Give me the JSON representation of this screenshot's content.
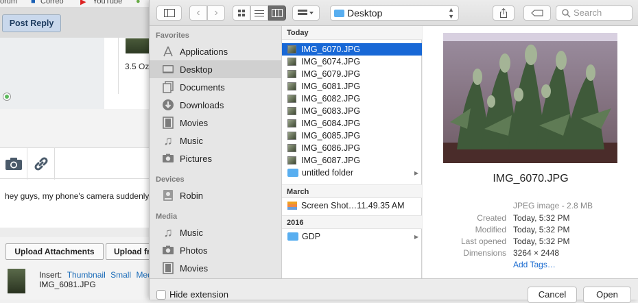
{
  "background": {
    "bookmarks": [
      "orum",
      "Correo",
      "YouTube"
    ],
    "post_reply": "Post Reply",
    "post_text": "3.5 Oz",
    "message": "hey guys, my phone's camera suddenly",
    "upload_button": "Upload Attachments",
    "upload_button2": "Upload fr",
    "insert_label": "Insert:",
    "insert_links": [
      "Thumbnail",
      "Small",
      "Med"
    ],
    "attachment_name": "IMG_6081.JPG"
  },
  "dialog": {
    "location": "Desktop",
    "search_placeholder": "Search",
    "sidebar": {
      "favorites_header": "Favorites",
      "favorites": [
        {
          "label": "Applications",
          "icon": "applications-icon"
        },
        {
          "label": "Desktop",
          "icon": "desktop-icon",
          "selected": true
        },
        {
          "label": "Documents",
          "icon": "documents-icon"
        },
        {
          "label": "Downloads",
          "icon": "downloads-icon"
        },
        {
          "label": "Movies",
          "icon": "movies-icon"
        },
        {
          "label": "Music",
          "icon": "music-icon"
        },
        {
          "label": "Pictures",
          "icon": "pictures-icon"
        }
      ],
      "devices_header": "Devices",
      "devices": [
        {
          "label": "Robin",
          "icon": "harddisk-icon"
        }
      ],
      "media_header": "Media",
      "media": [
        {
          "label": "Music",
          "icon": "music-icon"
        },
        {
          "label": "Photos",
          "icon": "photos-icon"
        },
        {
          "label": "Movies",
          "icon": "movies-icon"
        }
      ]
    },
    "groups": [
      {
        "header": "Today",
        "items": [
          "IMG_6070.JPG",
          "IMG_6074.JPG",
          "IMG_6079.JPG",
          "IMG_6081.JPG",
          "IMG_6082.JPG",
          "IMG_6083.JPG",
          "IMG_6084.JPG",
          "IMG_6085.JPG",
          "IMG_6086.JPG",
          "IMG_6087.JPG",
          "untitled folder"
        ]
      },
      {
        "header": "March",
        "items": [
          "Screen Shot…11.49.35 AM"
        ]
      },
      {
        "header": "2016",
        "items": [
          "GDP"
        ]
      }
    ],
    "selected_file": "IMG_6070.JPG",
    "preview": {
      "name": "IMG_6070.JPG",
      "kind": "JPEG image - 2.8 MB",
      "rows": [
        {
          "k": "Created",
          "v": "Today, 5:32 PM"
        },
        {
          "k": "Modified",
          "v": "Today, 5:32 PM"
        },
        {
          "k": "Last opened",
          "v": "Today, 5:32 PM"
        },
        {
          "k": "Dimensions",
          "v": "3264 × 2448"
        }
      ],
      "add_tags": "Add Tags…"
    },
    "hide_extension": "Hide extension",
    "cancel": "Cancel",
    "open": "Open",
    "colors": {
      "selection": "#1868d6",
      "link": "#1a6bb8"
    }
  }
}
